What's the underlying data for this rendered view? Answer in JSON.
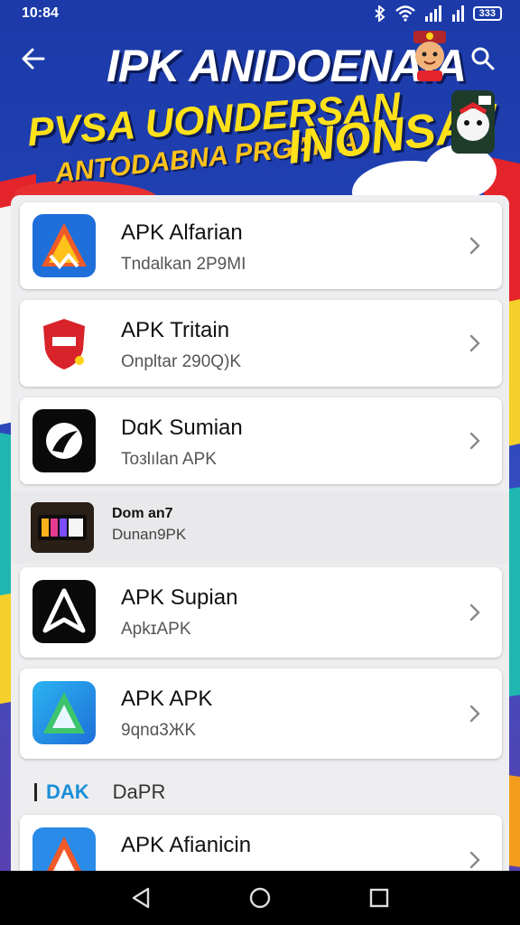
{
  "status_bar": {
    "time": "10:84",
    "battery": "333",
    "icons": [
      "bluetooth-icon",
      "wifi-icon",
      "signal-icon",
      "signal-icon",
      "battery-icon"
    ]
  },
  "header": {
    "title": "IPK ANIDOENAIA",
    "banner_line1": "PVSA UONDERSAN",
    "banner_line2": "ANTODABNA PRGAN A",
    "banner_line3": "INONSAI/",
    "back_icon": "back-arrow-icon",
    "search_icon": "search-icon"
  },
  "colors": {
    "background": "#1c3aa8",
    "accent_yellow": "#ffe11a",
    "accent_blue": "#1a8fd8",
    "panel": "#eeeef0"
  },
  "apps": [
    {
      "title": "APK Alfarian",
      "subtitle": "Tndalkan 2P9MI",
      "icon": "triangle-logo-icon"
    },
    {
      "title": "APK Tritain",
      "subtitle": "Onpltar 290Q)K",
      "icon": "shield-logo-icon"
    },
    {
      "title": "DɑK Sumian",
      "subtitle": "Toзlılan APK",
      "icon": "circle-logo-icon"
    }
  ],
  "flat_item": {
    "title": "Dom an7",
    "subtitle": "Dunan9PK",
    "icon": "dark-logo-icon"
  },
  "apps_2": [
    {
      "title": "APK Supian",
      "subtitle": "ApkɪAPK",
      "icon": "a-logo-icon"
    },
    {
      "title": "APK APK",
      "subtitle": "9qnɑ3ЖK",
      "icon": "gradient-a-logo-icon"
    }
  ],
  "section": {
    "accent": "DAK",
    "label": "DaPR"
  },
  "last_app": {
    "title": "APK Afianicin",
    "subtitle": "",
    "icon": "triangle-logo-icon"
  },
  "nav": {
    "back_icon": "nav-back-icon",
    "home_icon": "nav-home-icon",
    "recents_icon": "nav-recents-icon"
  }
}
